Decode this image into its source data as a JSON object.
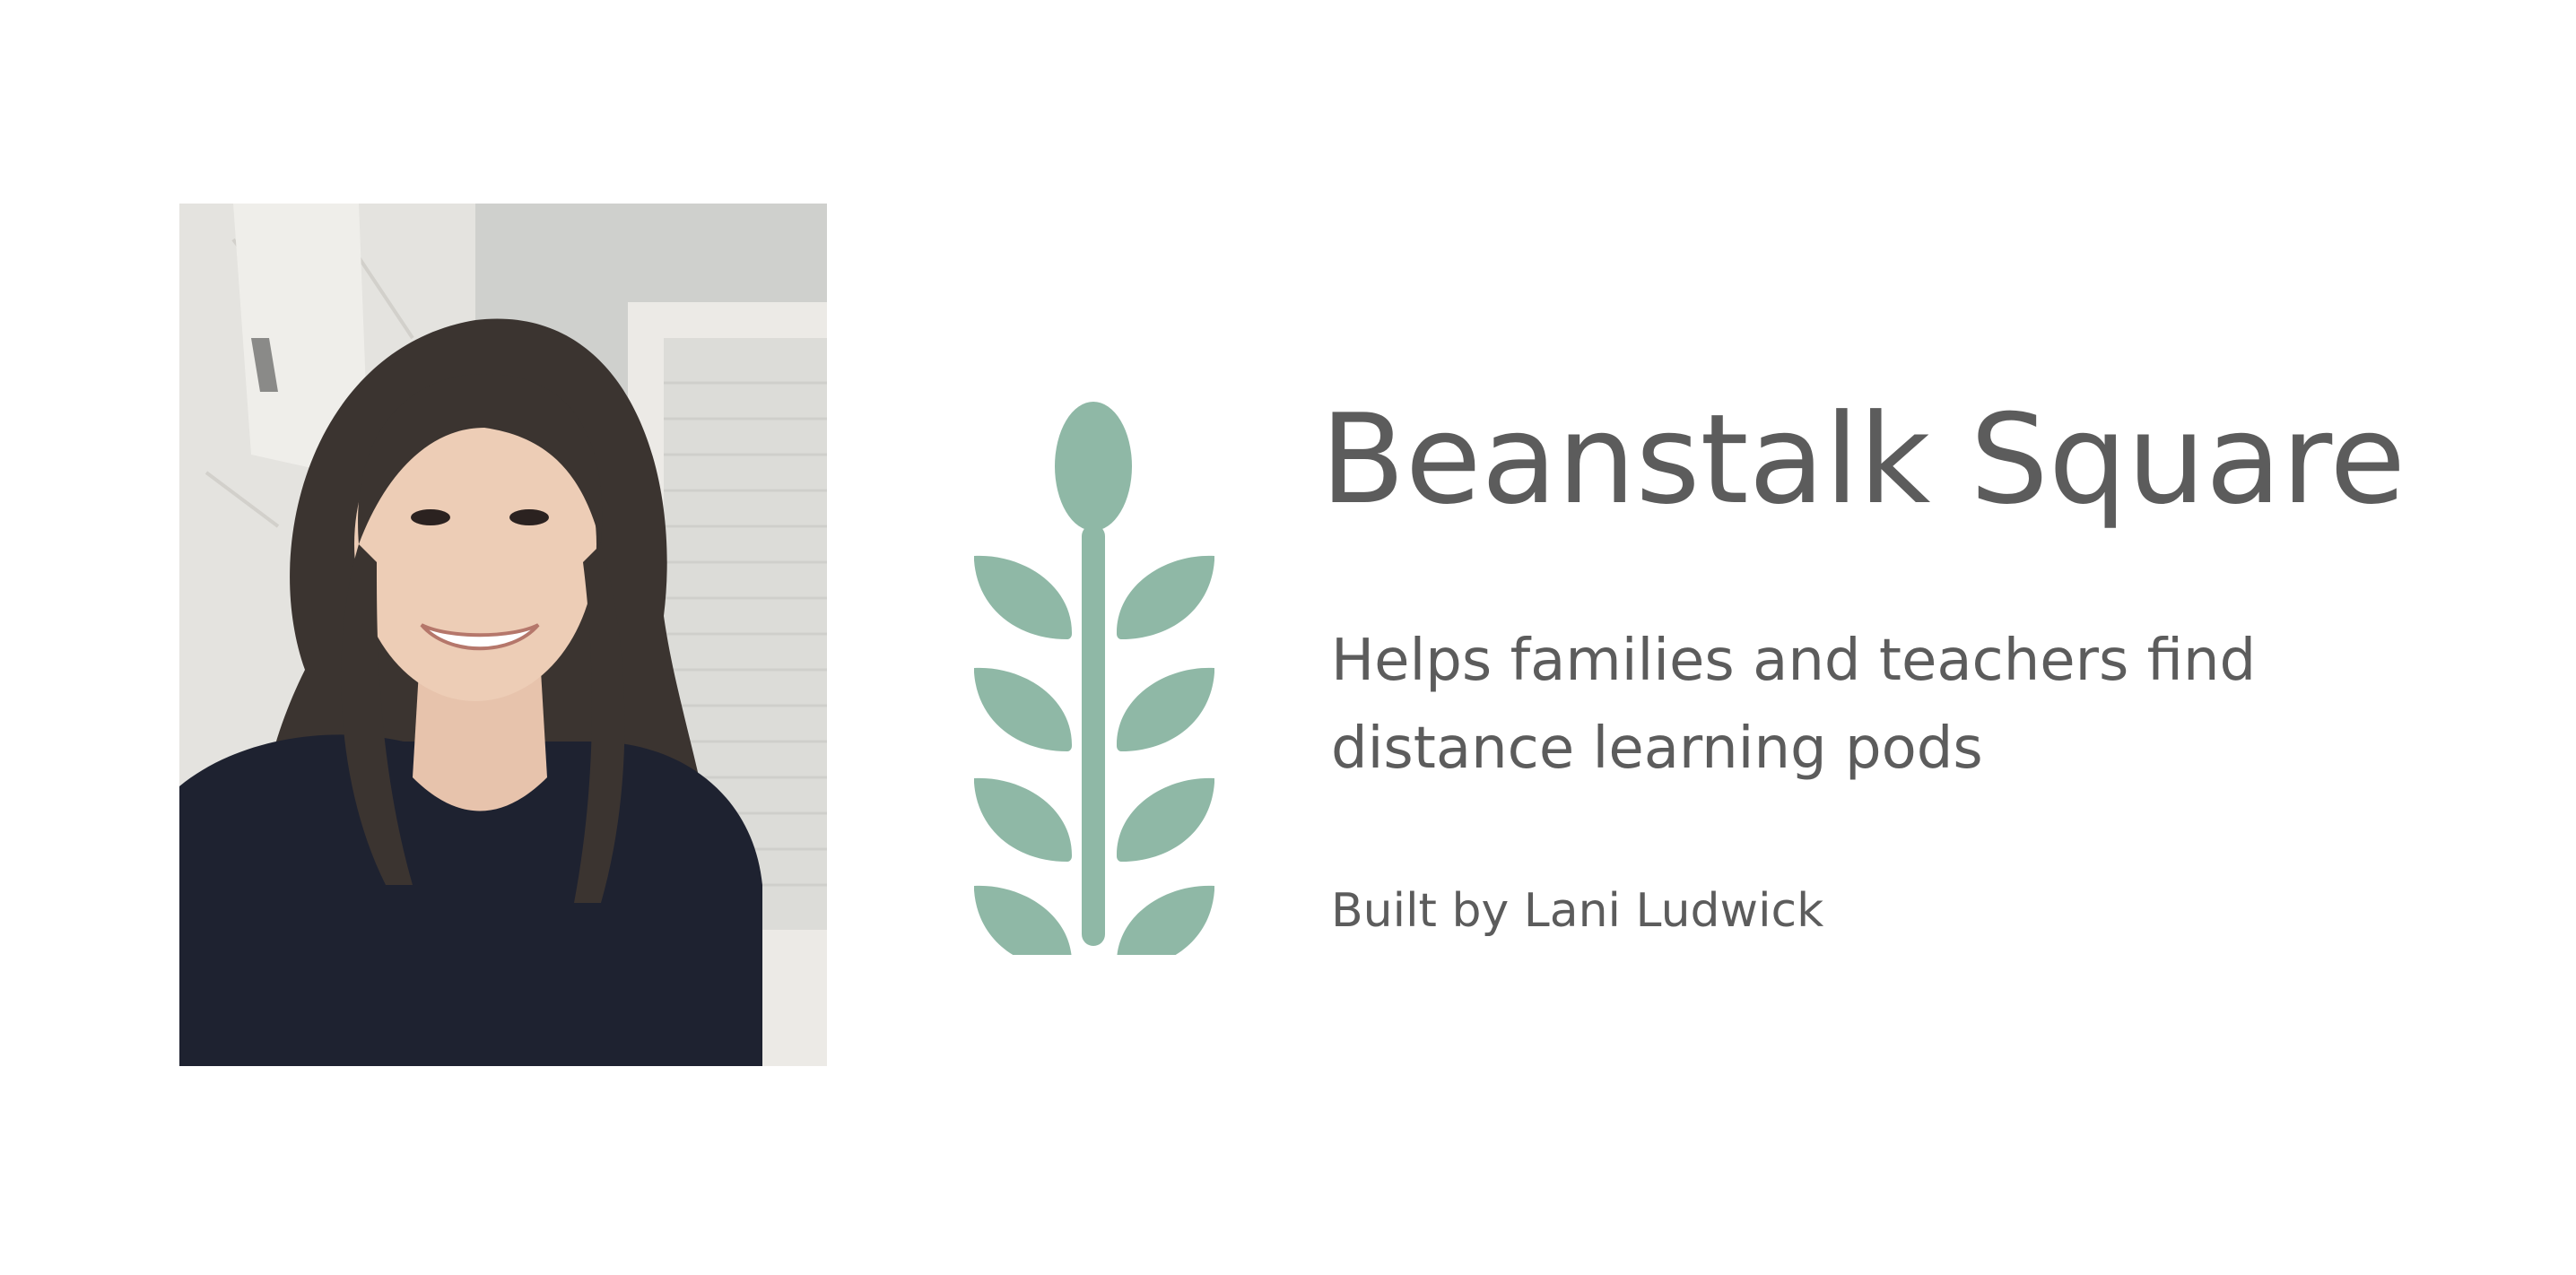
{
  "title": "Beanstalk Square",
  "tagline_lines": [
    "Helps families and teachers find",
    "distance learning pods"
  ],
  "byline": "Built by Lani Ludwick",
  "photo": {
    "description_icon": "portrait-photo"
  },
  "logo": {
    "icon": "wheat-sprout-icon",
    "color": "#8fb8a6"
  },
  "colors": {
    "text": "#5c5c5c",
    "background": "#ffffff"
  }
}
